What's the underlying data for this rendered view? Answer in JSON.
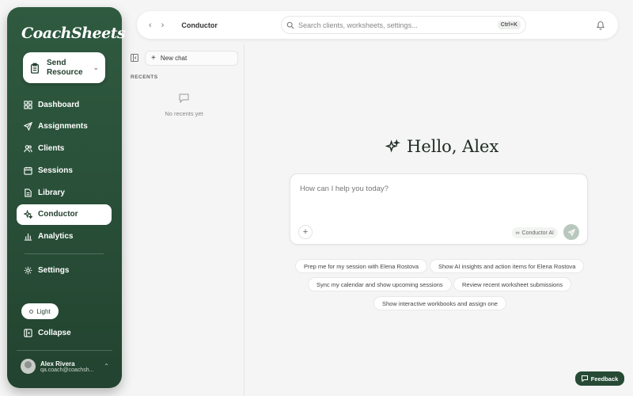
{
  "app": {
    "logo_text": "CoachSheets"
  },
  "sidebar": {
    "send_resource_label": "Send Resource",
    "items": [
      {
        "label": "Dashboard",
        "icon": "dashboard-icon"
      },
      {
        "label": "Assignments",
        "icon": "send-icon"
      },
      {
        "label": "Clients",
        "icon": "users-icon"
      },
      {
        "label": "Sessions",
        "icon": "calendar-icon"
      },
      {
        "label": "Library",
        "icon": "document-icon"
      },
      {
        "label": "Conductor",
        "icon": "sparkles-icon",
        "active": true
      },
      {
        "label": "Analytics",
        "icon": "bar-chart-icon"
      }
    ],
    "settings_label": "Settings",
    "theme_label": "Light",
    "collapse_label": "Collapse",
    "user": {
      "name": "Alex Rivera",
      "email": "qa.coach@coachsh..."
    }
  },
  "topbar": {
    "breadcrumb": "Conductor",
    "search_placeholder": "Search clients, worksheets, settings...",
    "shortcut": "Ctrl+K"
  },
  "recents": {
    "new_chat_label": "New chat",
    "title": "RECENTS",
    "empty_text": "No recents yet"
  },
  "main": {
    "greeting": "Hello, Alex",
    "composer_placeholder": "How can I help you today?",
    "ai_badge": "Conductor AI",
    "suggestions": [
      "Prep me for my session with Elena Rostova",
      "Show AI insights and action items for Elena Rostova",
      "Sync my calendar and show upcoming sessions",
      "Review recent worksheet submissions",
      "Show interactive workbooks and assign one"
    ]
  },
  "feedback_label": "Feedback",
  "colors": {
    "sidebar": "#2f5a40",
    "accent": "#274a35",
    "background": "#f4f5f4"
  }
}
